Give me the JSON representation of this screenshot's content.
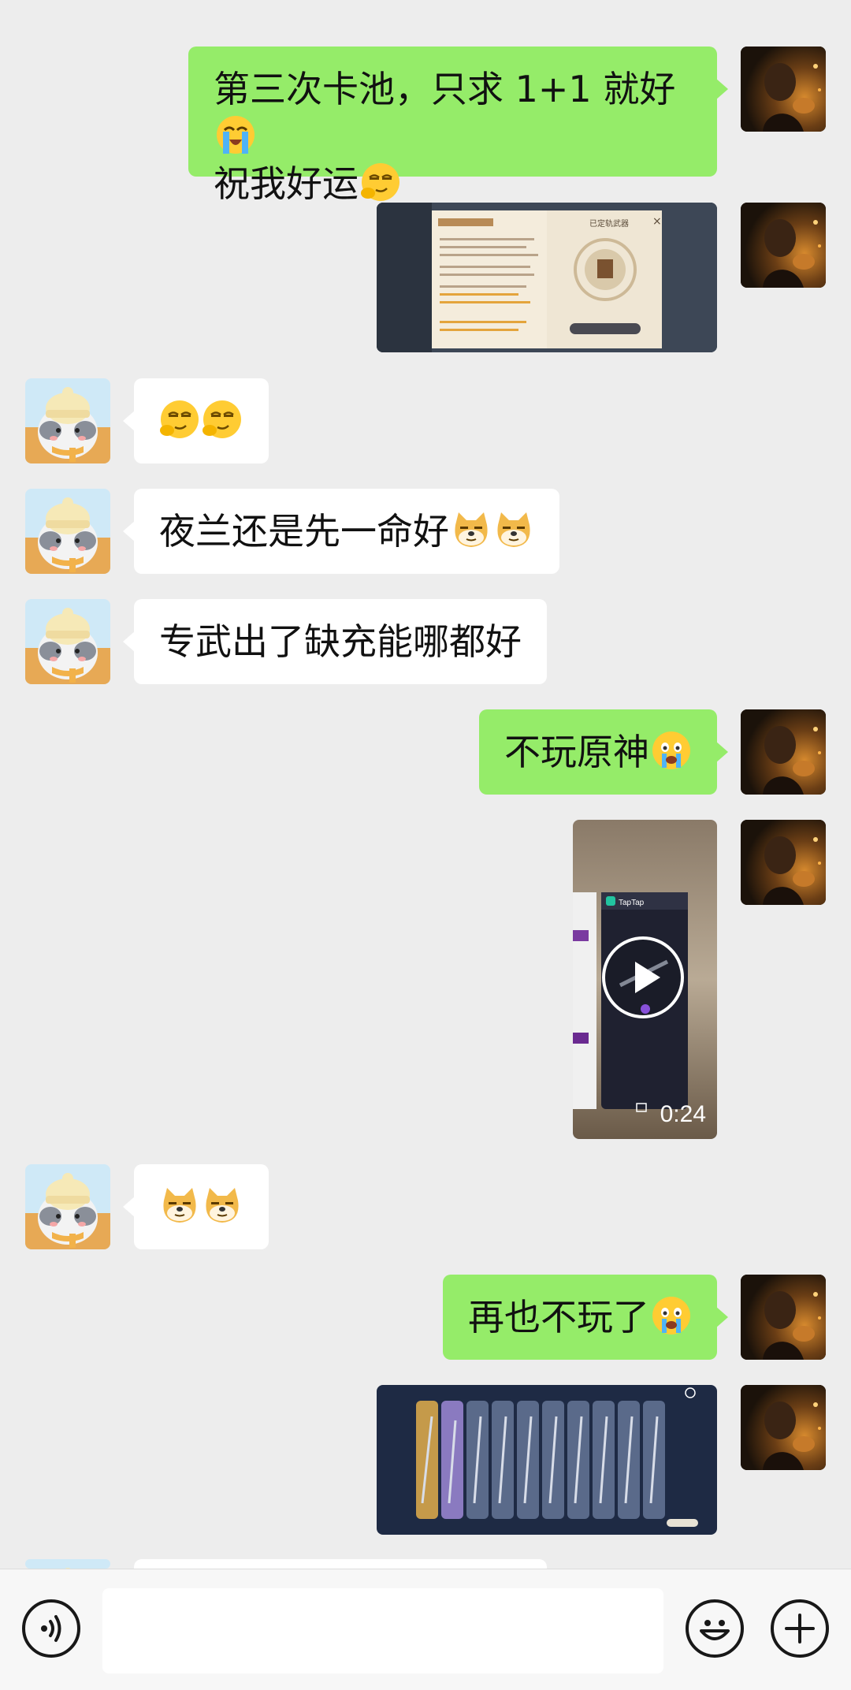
{
  "messages": [
    {
      "sender": "me",
      "type": "text",
      "line1": "第三次卡池，只求 1+1 就好",
      "line2": "祝我好运",
      "emoji_line1": "loudly-crying",
      "emoji_line2": "smirking-face"
    },
    {
      "sender": "me",
      "type": "image",
      "content": "screenshot-weapon-banner-dialog",
      "dialog_title": "已定轨武器"
    },
    {
      "sender": "them",
      "type": "emoji",
      "emojis": [
        "smirking-face",
        "smirking-face"
      ]
    },
    {
      "sender": "them",
      "type": "text",
      "text": "夜兰还是先一命好",
      "emojis": [
        "doge",
        "doge"
      ]
    },
    {
      "sender": "them",
      "type": "text",
      "text": "专武出了缺充能哪都好"
    },
    {
      "sender": "me",
      "type": "text",
      "text": "不玩原神",
      "emojis": [
        "crying-face"
      ]
    },
    {
      "sender": "me",
      "type": "video",
      "duration": "0:24",
      "app_label": "TapTap"
    },
    {
      "sender": "them",
      "type": "emoji",
      "emojis": [
        "doge",
        "doge"
      ]
    },
    {
      "sender": "me",
      "type": "text",
      "text": "再也不玩了",
      "emojis": [
        "crying-face"
      ]
    },
    {
      "sender": "me",
      "type": "image",
      "content": "screenshot-wish-results"
    }
  ],
  "input_bar": {
    "voice_icon": "voice-icon",
    "emoji_icon": "emoji-icon",
    "plus_icon": "plus-icon",
    "text_value": ""
  },
  "colors": {
    "background": "#ededed",
    "my_bubble": "#95ec69",
    "their_bubble": "#ffffff",
    "input_bar": "#f7f7f7"
  }
}
